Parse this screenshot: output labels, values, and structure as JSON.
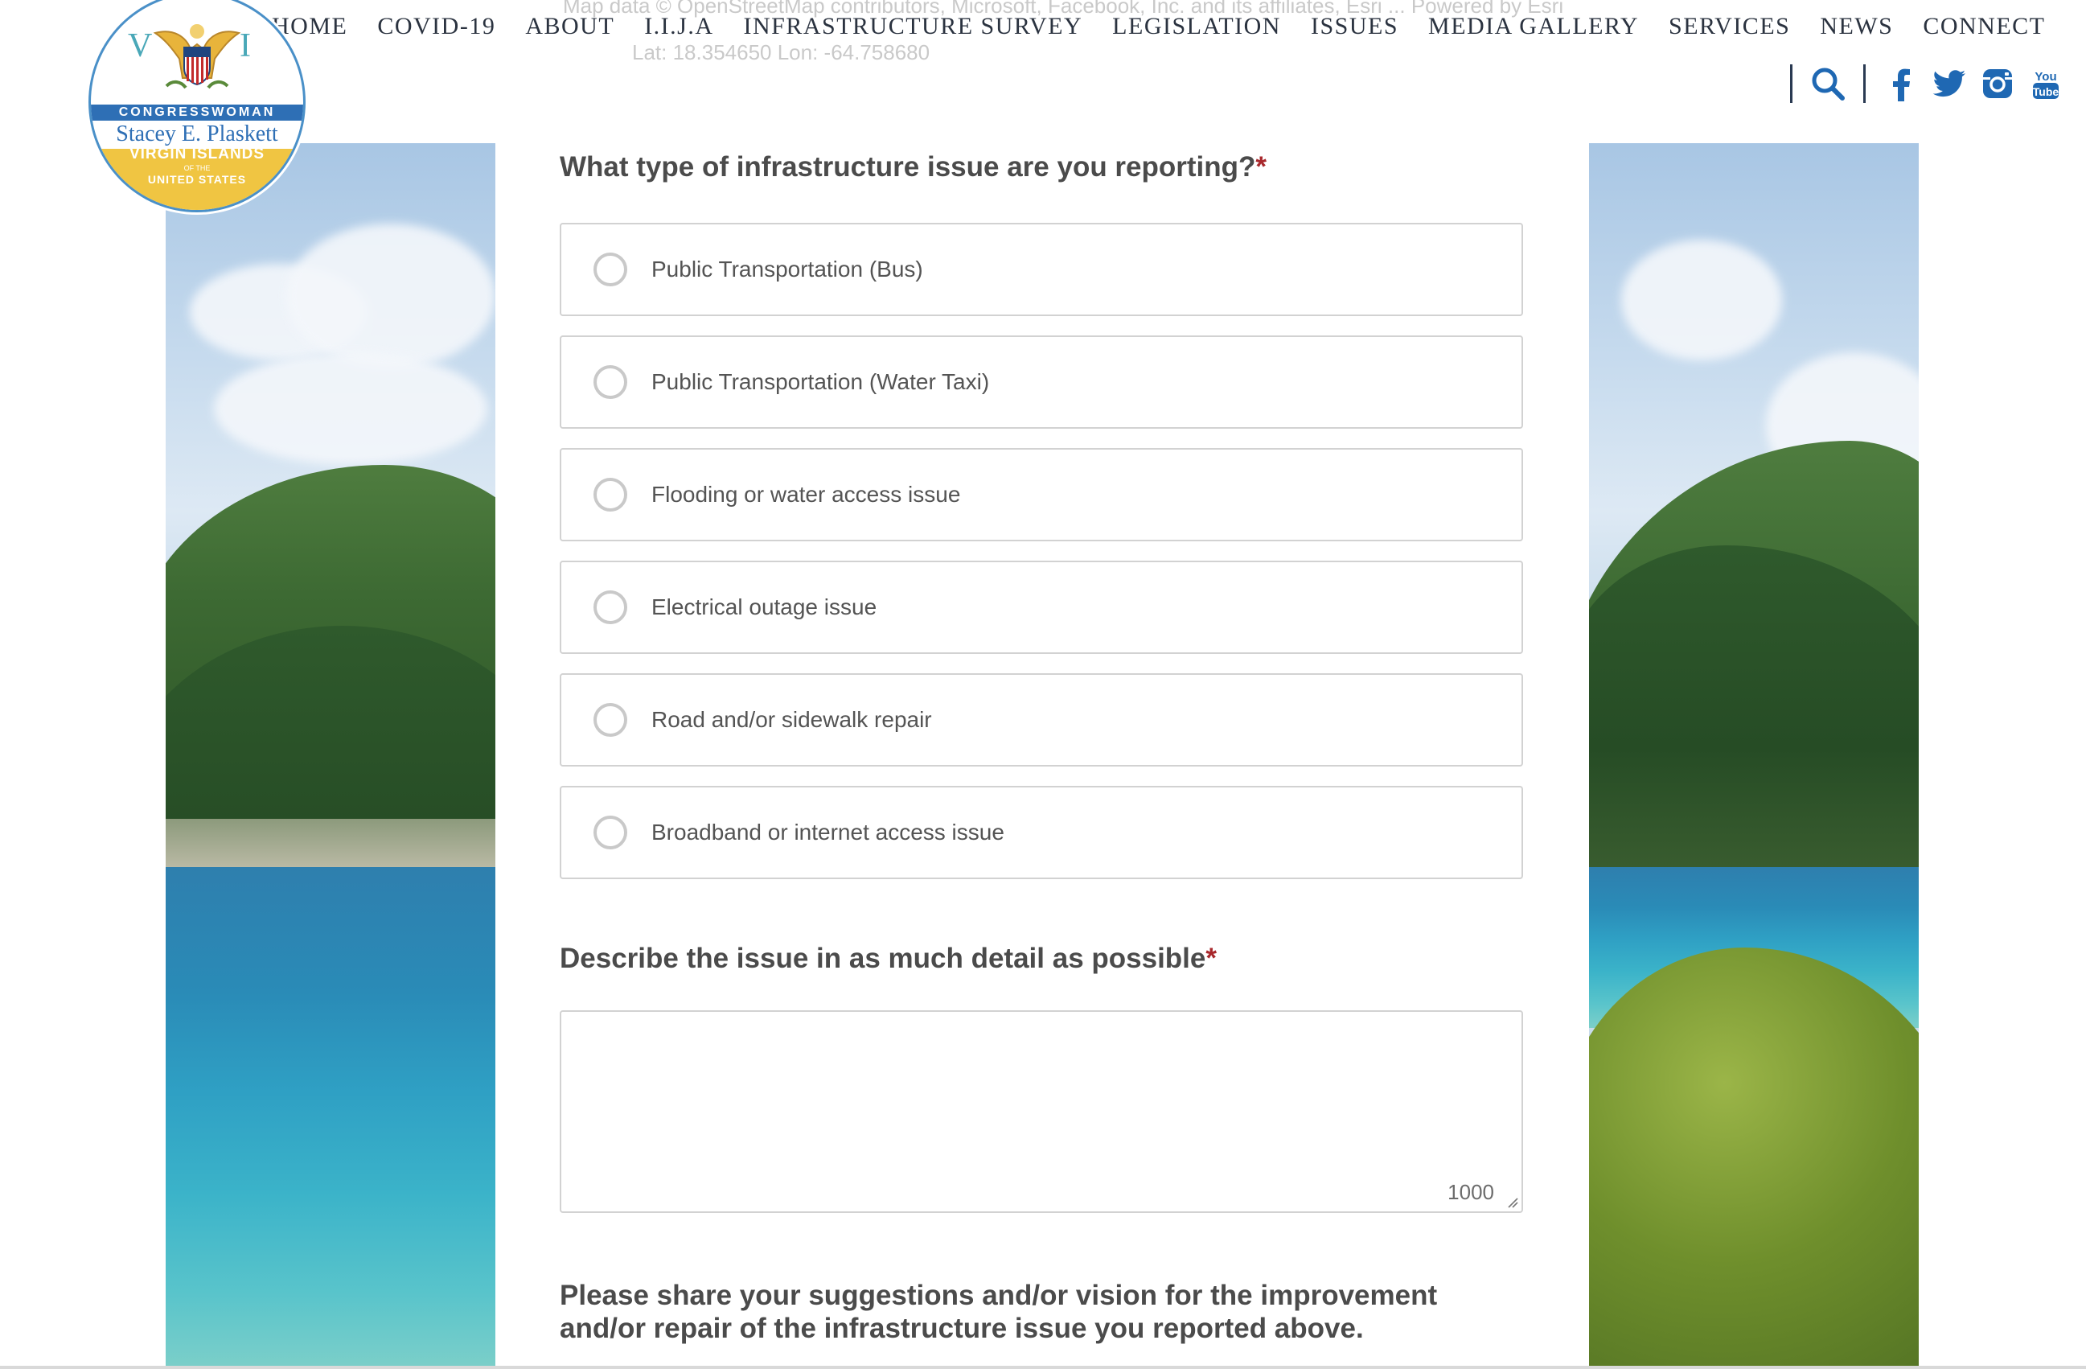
{
  "header": {
    "logo": {
      "title": "CONGRESSWOMAN",
      "name": "Stacey E. Plaskett",
      "region": "VIRGIN ISLANDS",
      "of_the": "OF THE",
      "country": "UNITED STATES",
      "letter_left": "V",
      "letter_right": "I",
      "emblem": "eagle-seal-icon"
    },
    "nav": [
      "HOME",
      "COVID-19",
      "ABOUT",
      "I.I.J.A",
      "INFRASTRUCTURE SURVEY",
      "LEGISLATION",
      "ISSUES",
      "MEDIA GALLERY",
      "SERVICES",
      "NEWS",
      "CONNECT"
    ],
    "ghost_attribution": "Map data © OpenStreetMap contributors, Microsoft, Facebook, Inc. and its affiliates, Esri ... Powered by Esri",
    "ghost_coords": "Lat: 18.354650  Lon: -64.758680",
    "social": [
      "search-icon",
      "facebook-icon",
      "twitter-icon",
      "instagram-icon",
      "youtube-icon"
    ],
    "youtube_text_top": "You",
    "youtube_text_bottom": "Tube"
  },
  "form": {
    "q1": {
      "label": "What type of infrastructure issue are you reporting?",
      "required": "*"
    },
    "options": [
      "Public Transportation (Bus)",
      "Public Transportation (Water Taxi)",
      "Flooding or water access issue",
      "Electrical outage issue",
      "Road and/or sidewalk repair",
      "Broadband or internet access issue"
    ],
    "q2": {
      "label": "Describe the issue in as much detail as possible",
      "required": "*",
      "value": "",
      "counter": "1000"
    },
    "q3": {
      "label": "Please share your suggestions and/or vision for the improvement and/or repair of the infrastructure issue you reported above."
    }
  },
  "colors": {
    "required": "#a8282c",
    "nav_text": "#2b3340",
    "icon": "#1f68b3",
    "border": "#d2d2d2"
  }
}
